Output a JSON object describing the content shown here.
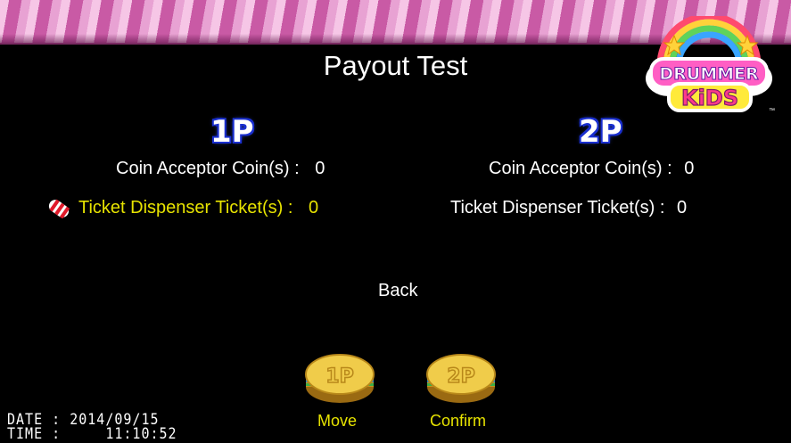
{
  "screen": {
    "title": "Payout Test",
    "logo_text_top": "DRUMMER",
    "logo_text_bottom": "KiDS",
    "logo_trademark": "™"
  },
  "players": {
    "p1": {
      "heading": "1P",
      "coin_label": "Coin Acceptor  Coin(s) :",
      "coin_value": "0",
      "ticket_label": "Ticket Dispenser  Ticket(s) :",
      "ticket_value": "0",
      "selected_row": "ticket"
    },
    "p2": {
      "heading": "2P",
      "coin_label": "Coin Acceptor  Coin(s) :",
      "coin_value": "0",
      "ticket_label": "Ticket Dispenser  Ticket(s) :",
      "ticket_value": "0"
    }
  },
  "menu": {
    "back_label": "Back"
  },
  "controls": {
    "btn1_glyph": "1P",
    "btn1_label": "Move",
    "btn2_glyph": "2P",
    "btn2_label": "Confirm"
  },
  "status": {
    "date_line": "DATE : 2014/09/15",
    "time_line": "TIME :     11:10:52"
  },
  "colors": {
    "highlight": "#e7e300",
    "heading_outline": "#1a2fd0",
    "button_gold": "#e0b83a"
  }
}
